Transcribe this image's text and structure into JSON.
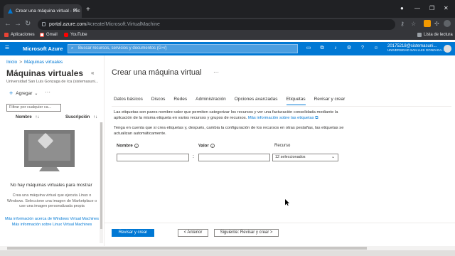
{
  "browser": {
    "tab_title": "Crear una máquina virtual - Mic",
    "url_host": "portal.azure.com",
    "url_path": "/#create/Microsoft.VirtualMachine",
    "bookmarks": [
      "Aplicaciones",
      "Gmail",
      "YouTube"
    ],
    "reading_list": "Lista de lectura"
  },
  "portal": {
    "brand": "Microsoft Azure",
    "search_placeholder": "Buscar recursos, servicios y documentos (G+/)",
    "account_name": "20175218@sistemasuni...",
    "account_org": "UNIVERSIDAD SAN LUIS GONZAGA..."
  },
  "breadcrumb": {
    "home": "Inicio",
    "current": "Máquinas virtuales"
  },
  "left_panel": {
    "title": "Máquinas virtuales",
    "subtitle": "Universidad San Luis Gonzaga de Ica (sistemasuni...",
    "add_label": "Agregar",
    "filter_placeholder": "Filtrar por cualquier ca...",
    "col_name": "Nombre",
    "col_subscription": "Suscripción",
    "empty_title": "No hay máquinas virtuales para mostrar",
    "empty_desc": "Crea una máquina virtual que ejecuta Linux o Windows. Seleccione una imagen de Marketplace o use una imagen personalizada propia",
    "link_windows": "Más información acerca de Windows Virtual Machines",
    "link_linux": "Más información sobre Linux Virtual Machines"
  },
  "main": {
    "title": "Crear una máquina virtual",
    "tabs": [
      "Datos básicos",
      "Discos",
      "Redes",
      "Administración",
      "Opciones avanzadas",
      "Etiquetas",
      "Revisar y crear"
    ],
    "active_tab": "Etiquetas",
    "intro": "Las etiquetas son pares nombre-valor que permiten categorizar los recursos y ver una facturación consolidada mediante la aplicación de la misma etiqueta en varios recursos y grupos de recursos.",
    "intro_link": "Más información sobre las etiquetas",
    "note": "Tenga en cuenta que si crea etiquetas y, después, cambia la configuración de los recursos en otras pestañas, las etiquetas se actualizan automáticamente.",
    "label_name": "Nombre",
    "label_value": "Valor",
    "label_resource": "Recurso",
    "resource_value": "12 seleccionados",
    "btn_review": "Revisar y crear",
    "btn_prev": "< Anterior",
    "btn_next": "Siguiente: Revisar y crear >"
  }
}
